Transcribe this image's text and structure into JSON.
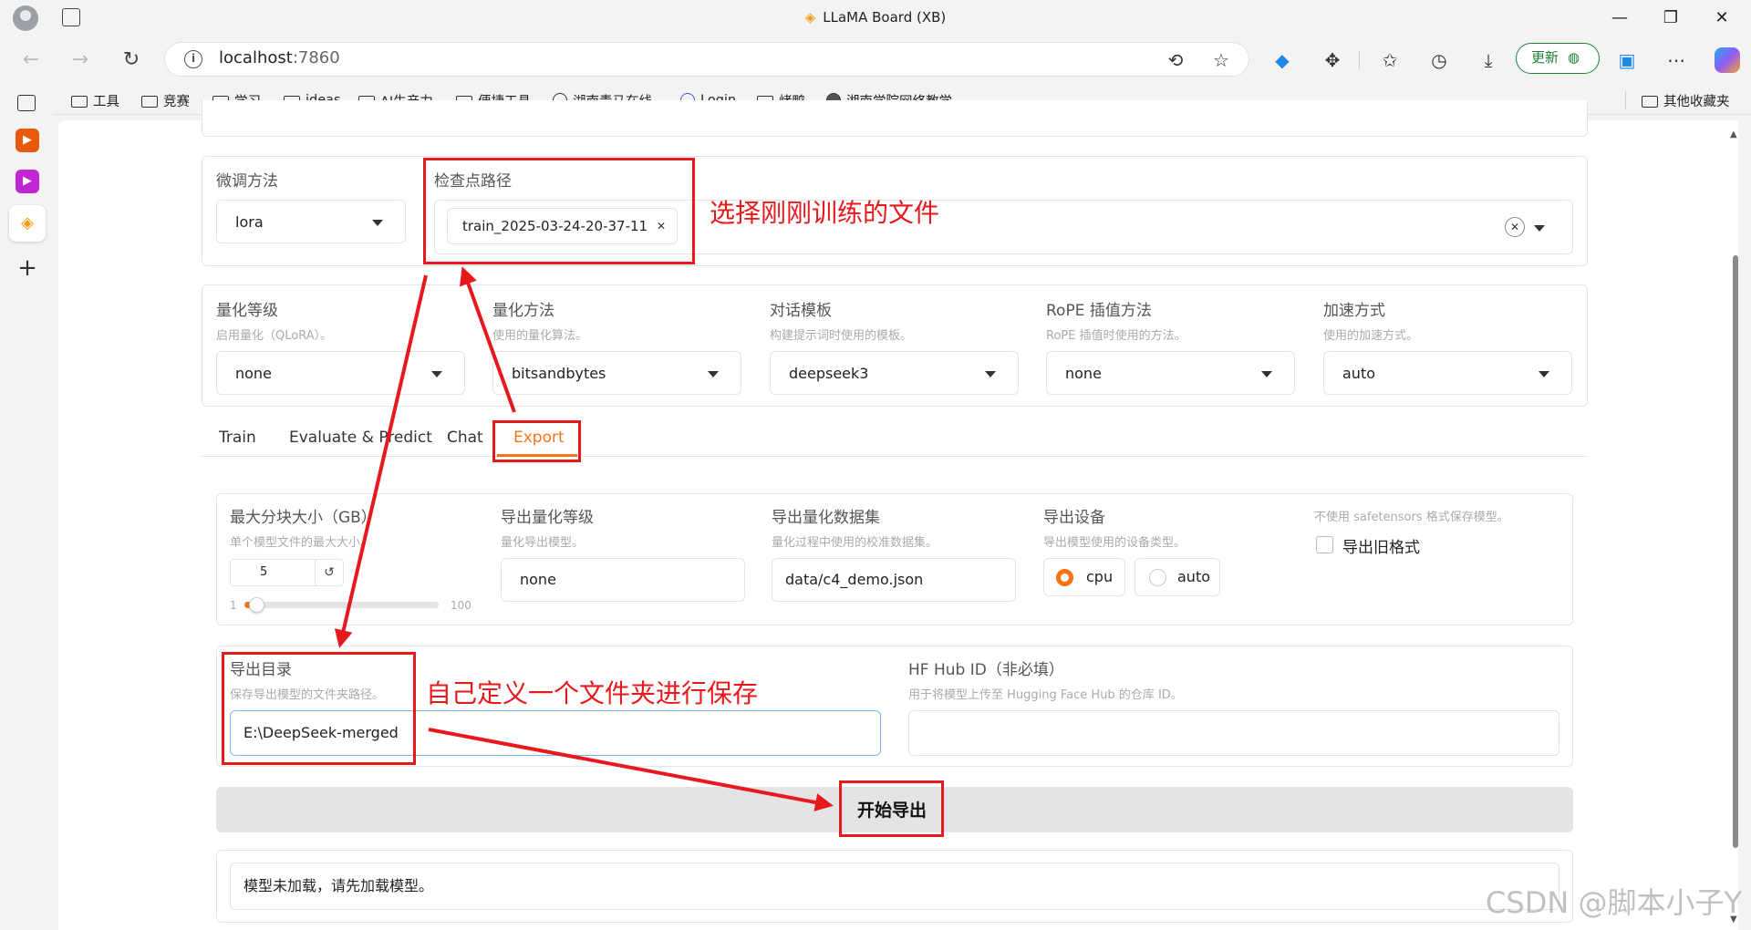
{
  "window": {
    "title": "LLaMA Board (XB)"
  },
  "address": {
    "host": "localhost",
    "port": ":7860"
  },
  "toolbar": {
    "update_label": "更新"
  },
  "bookmarks": [
    "工具",
    "竞赛",
    "学习",
    "ideas",
    "AI生产力",
    "便捷工具",
    "湖南青马在线",
    "Login",
    "烤鸭",
    "湘南学院网络教学..."
  ],
  "bookmarks_other": "其他收藏夹",
  "finetune": {
    "method_label": "微调方法",
    "method_value": "lora",
    "checkpoint_label": "检查点路径",
    "checkpoint_value": "train_2025-03-24-20-37-11"
  },
  "advanced": [
    {
      "label": "量化等级",
      "desc": "启用量化（QLoRA）。",
      "value": "none"
    },
    {
      "label": "量化方法",
      "desc": "使用的量化算法。",
      "value": "bitsandbytes"
    },
    {
      "label": "对话模板",
      "desc": "构建提示词时使用的模板。",
      "value": "deepseek3"
    },
    {
      "label": "RoPE 插值方法",
      "desc": "RoPE 插值时使用的方法。",
      "value": "none"
    },
    {
      "label": "加速方式",
      "desc": "使用的加速方式。",
      "value": "auto"
    }
  ],
  "tabs": [
    "Train",
    "Evaluate & Predict",
    "Chat",
    "Export"
  ],
  "active_tab": "Export",
  "export": {
    "shard_label": "最大分块大小（GB）",
    "shard_desc": "单个模型文件的最大大小。",
    "shard_value": "5",
    "shard_min": "1",
    "shard_max": "100",
    "shard_fraction": 0.04,
    "quant_label": "导出量化等级",
    "quant_desc": "量化导出模型。",
    "quant_value": "none",
    "dataset_label": "导出量化数据集",
    "dataset_desc": "量化过程中使用的校准数据集。",
    "dataset_value": "data/c4_demo.json",
    "device_label": "导出设备",
    "device_desc": "导出模型使用的设备类型。",
    "device_options": [
      "cpu",
      "auto"
    ],
    "device_selected": "cpu",
    "legacy_desc": "不使用 safetensors 格式保存模型。",
    "legacy_label": "导出旧格式",
    "dir_label": "导出目录",
    "dir_desc": "保存导出模型的文件夹路径。",
    "dir_value": "E:\\DeepSeek-merged",
    "hub_label": "HF Hub ID（非必填）",
    "hub_desc": "用于将模型上传至 Hugging Face Hub 的仓库 ID。",
    "hub_value": "",
    "start_button": "开始导出",
    "status": "模型未加载，请先加载模型。"
  },
  "annotations": {
    "select_file": "选择刚刚训练的文件",
    "custom_folder": "自己定义一个文件夹进行保存"
  },
  "watermark": "CSDN @脚本小子Y",
  "colors": {
    "accent": "#f97316",
    "annotation": "#e8191d",
    "update_green": "#1e7e34"
  }
}
